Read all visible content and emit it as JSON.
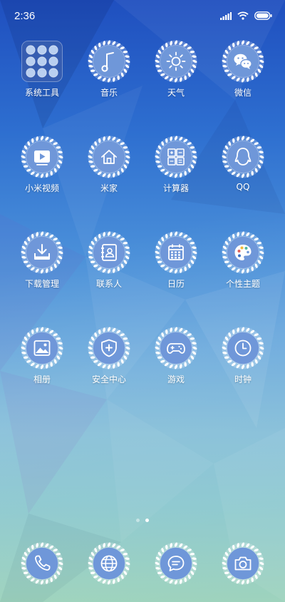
{
  "status_bar": {
    "time": "2:36",
    "icons": [
      "signal-icon",
      "wifi-icon",
      "battery-icon"
    ]
  },
  "apps": [
    {
      "label": "系统工具",
      "icon": "folder-grid-icon"
    },
    {
      "label": "音乐",
      "icon": "music-note-icon"
    },
    {
      "label": "天气",
      "icon": "sun-icon"
    },
    {
      "label": "微信",
      "icon": "wechat-icon"
    },
    {
      "label": "小米视频",
      "icon": "video-play-icon"
    },
    {
      "label": "米家",
      "icon": "home-icon"
    },
    {
      "label": "计算器",
      "icon": "calculator-icon"
    },
    {
      "label": "QQ",
      "icon": "qq-penguin-icon"
    },
    {
      "label": "下载管理",
      "icon": "download-icon"
    },
    {
      "label": "联系人",
      "icon": "contacts-icon"
    },
    {
      "label": "日历",
      "icon": "calendar-icon"
    },
    {
      "label": "个性主题",
      "icon": "palette-icon"
    },
    {
      "label": "相册",
      "icon": "gallery-icon"
    },
    {
      "label": "安全中心",
      "icon": "shield-icon"
    },
    {
      "label": "游戏",
      "icon": "gamepad-icon"
    },
    {
      "label": "时钟",
      "icon": "clock-icon"
    }
  ],
  "page_indicator": {
    "pages": 2,
    "current": 2
  },
  "dock": [
    {
      "icon": "phone-icon"
    },
    {
      "icon": "browser-globe-icon"
    },
    {
      "icon": "message-icon"
    },
    {
      "icon": "camera-icon"
    }
  ],
  "colors": {
    "gradient_top": "#1f4fbf",
    "gradient_bottom": "#9ed3bd",
    "icon_badge": "#6f97d9"
  }
}
